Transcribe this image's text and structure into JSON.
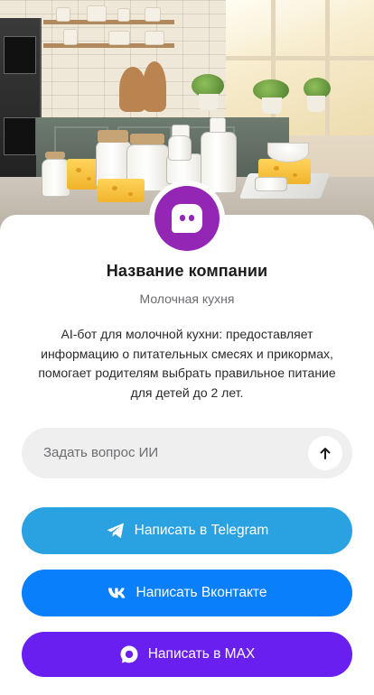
{
  "company": {
    "name": "Название компании",
    "subtitle": "Молочная кухня",
    "description": "AI-бот для молочной кухни: предоставляет информацию о питательных смесях и прикормах, помогает родителям выбрать правильное питание для детей до 2 лет.",
    "avatar_color": "#9326b5"
  },
  "ask": {
    "placeholder": "Задать вопрос ИИ",
    "send_icon": "arrow-up-icon"
  },
  "actions": [
    {
      "label": "Написать в Telegram",
      "icon": "telegram-icon",
      "color": "#2aa1e0"
    },
    {
      "label": "Написать Вконтакте",
      "icon": "vk-icon",
      "color": "#0a7ffb"
    },
    {
      "label": "Написать в MAX",
      "icon": "max-icon",
      "color": "#6a1ff1"
    }
  ]
}
